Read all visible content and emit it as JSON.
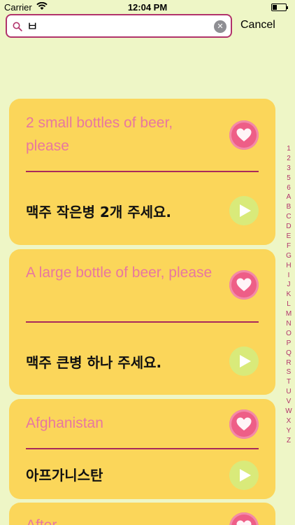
{
  "status_bar": {
    "carrier": "Carrier",
    "time": "12:04 PM"
  },
  "search": {
    "value": "ㅂ",
    "cancel_label": "Cancel"
  },
  "cards": [
    {
      "english": "2 small bottles of beer, please",
      "korean": "맥주 작은병 2개 주세요."
    },
    {
      "english": "A large bottle of beer, please",
      "korean": "맥주 큰병 하나 주세요."
    },
    {
      "english": "Afghanistan",
      "korean": "아프가니스탄"
    },
    {
      "english": "After",
      "korean": ""
    }
  ],
  "index": [
    "1",
    "2",
    "3",
    "5",
    "6",
    "A",
    "B",
    "C",
    "D",
    "E",
    "F",
    "G",
    "H",
    "I",
    "J",
    "K",
    "L",
    "M",
    "N",
    "O",
    "P",
    "Q",
    "R",
    "S",
    "T",
    "U",
    "V",
    "W",
    "X",
    "Y",
    "Z"
  ],
  "colors": {
    "background": "#eef6c6",
    "card": "#fbd65a",
    "accent": "#b1336b",
    "english_text": "#e8779f",
    "heart_button": "#ee5e87",
    "play_button": "#d9ea7a"
  }
}
